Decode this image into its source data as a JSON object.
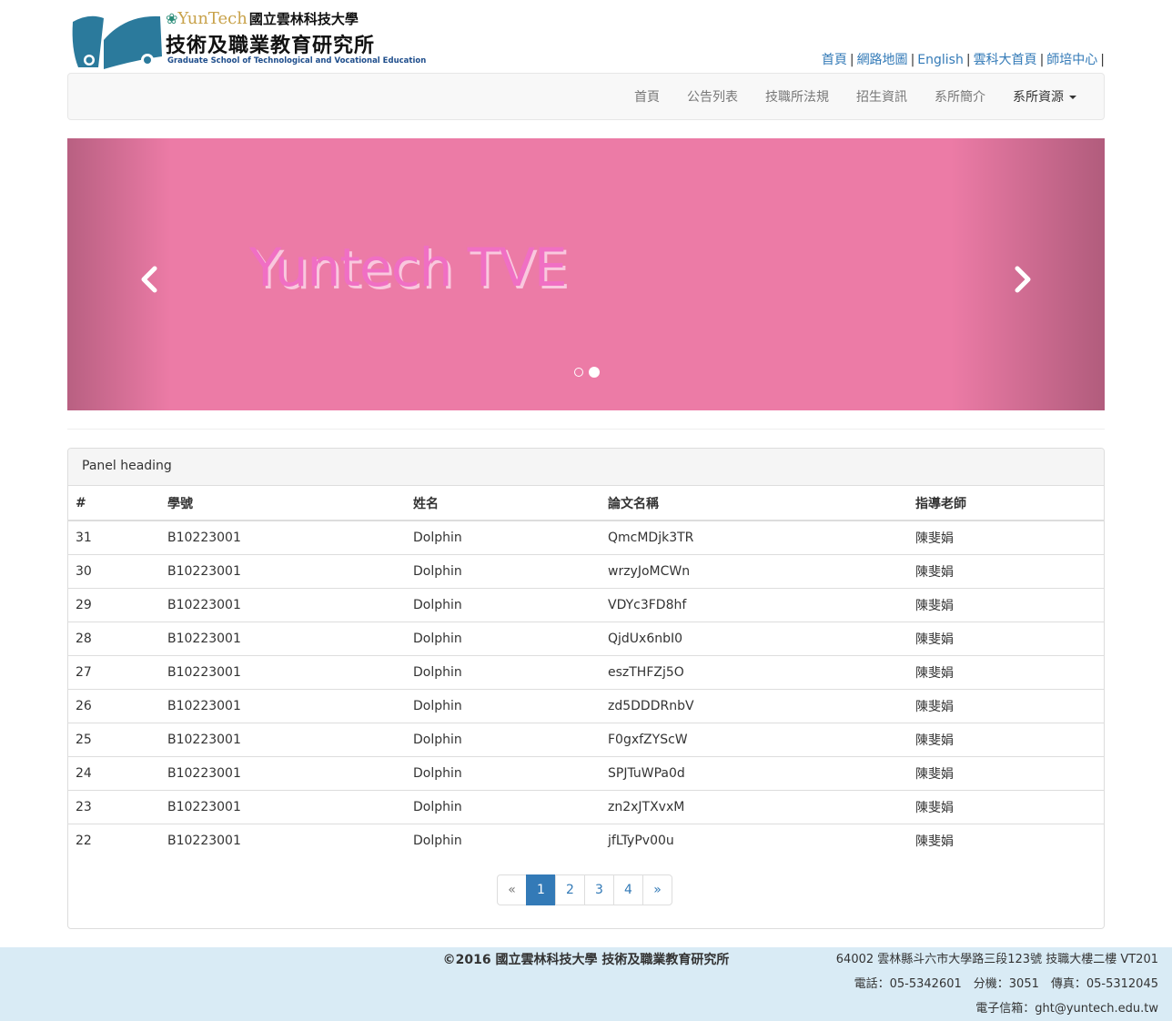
{
  "header": {
    "logo_brand": "YunTech",
    "logo_university": "國立雲林科技大學",
    "logo_title": "技術及職業教育研究所",
    "logo_subtitle": "Graduate School of Technological and Vocational Education",
    "top_links": [
      "首頁",
      "網路地圖",
      "English",
      "雲科大首頁",
      "師培中心"
    ],
    "separator": "|"
  },
  "navbar": {
    "items": [
      "首頁",
      "公告列表",
      "技職所法規",
      "招生資訊",
      "系所簡介"
    ],
    "dropdown_label": "系所資源"
  },
  "carousel": {
    "caption": "Yuntech TVE",
    "prev_glyph": "‹",
    "next_glyph": "›",
    "slide_count": 2,
    "active_slide": 2,
    "background_color": "#ec7ba6"
  },
  "panel": {
    "heading": "Panel heading",
    "columns": [
      "#",
      "學號",
      "姓名",
      "論文名稱",
      "指導老師"
    ],
    "rows": [
      [
        "31",
        "B10223001",
        "Dolphin",
        "QmcMDjk3TR",
        "陳斐娟"
      ],
      [
        "30",
        "B10223001",
        "Dolphin",
        "wrzyJoMCWn",
        "陳斐娟"
      ],
      [
        "29",
        "B10223001",
        "Dolphin",
        "VDYc3FD8hf",
        "陳斐娟"
      ],
      [
        "28",
        "B10223001",
        "Dolphin",
        "QjdUx6nbI0",
        "陳斐娟"
      ],
      [
        "27",
        "B10223001",
        "Dolphin",
        "eszTHFZj5O",
        "陳斐娟"
      ],
      [
        "26",
        "B10223001",
        "Dolphin",
        "zd5DDDRnbV",
        "陳斐娟"
      ],
      [
        "25",
        "B10223001",
        "Dolphin",
        "F0gxfZYScW",
        "陳斐娟"
      ],
      [
        "24",
        "B10223001",
        "Dolphin",
        "SPJTuWPa0d",
        "陳斐娟"
      ],
      [
        "23",
        "B10223001",
        "Dolphin",
        "zn2xJTXvxM",
        "陳斐娟"
      ],
      [
        "22",
        "B10223001",
        "Dolphin",
        "jfLTyPv00u",
        "陳斐娟"
      ]
    ]
  },
  "pagination": {
    "prev": "«",
    "pages": [
      "1",
      "2",
      "3",
      "4"
    ],
    "next": "»",
    "active": "1"
  },
  "footer": {
    "copyright": "©2016 國立雲林科技大學 技術及職業教育研究所",
    "address": "64002 雲林縣斗六市大學路三段123號 技職大樓二樓 VT201",
    "phone": "電話：05-5342601　分機：3051　傳真：05-5312045",
    "email": "電子信箱：ght@yuntech.edu.tw"
  },
  "colors": {
    "link": "#337ab7",
    "footer_bg": "#d9ebf5",
    "logo_blue": "#2b7a9c"
  }
}
